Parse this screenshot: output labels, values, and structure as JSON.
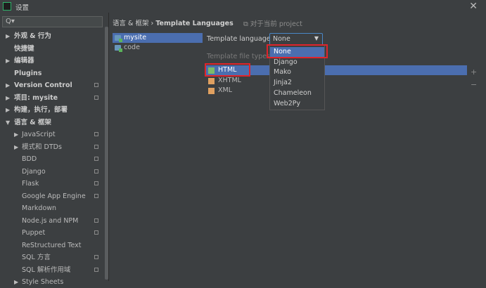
{
  "window": {
    "title": "设置"
  },
  "search": {
    "placeholder": ""
  },
  "sidebar": {
    "items": [
      {
        "label": "外观 & 行为",
        "arrow": "▶",
        "bold": true,
        "indent": 0
      },
      {
        "label": "快捷键",
        "arrow": "",
        "bold": true,
        "indent": 0
      },
      {
        "label": "编辑器",
        "arrow": "▶",
        "bold": true,
        "indent": 0
      },
      {
        "label": "Plugins",
        "arrow": "",
        "bold": true,
        "indent": 0
      },
      {
        "label": "Version Control",
        "arrow": "▶",
        "bold": true,
        "indent": 0,
        "copy": true
      },
      {
        "label": "项目: mysite",
        "arrow": "▶",
        "bold": true,
        "indent": 0,
        "copy": true
      },
      {
        "label": "构建，执行，部署",
        "arrow": "▶",
        "bold": true,
        "indent": 0
      },
      {
        "label": "语言 & 框架",
        "arrow": "▼",
        "bold": true,
        "indent": 0
      },
      {
        "label": "JavaScript",
        "arrow": "▶",
        "bold": false,
        "indent": 1,
        "copy": true
      },
      {
        "label": "模式和 DTDs",
        "arrow": "▶",
        "bold": false,
        "indent": 1,
        "copy": true
      },
      {
        "label": "BDD",
        "arrow": "",
        "bold": false,
        "indent": 1,
        "copy": true
      },
      {
        "label": "Django",
        "arrow": "",
        "bold": false,
        "indent": 1,
        "copy": true
      },
      {
        "label": "Flask",
        "arrow": "",
        "bold": false,
        "indent": 1,
        "copy": true
      },
      {
        "label": "Google App Engine",
        "arrow": "",
        "bold": false,
        "indent": 1,
        "copy": true
      },
      {
        "label": "Markdown",
        "arrow": "",
        "bold": false,
        "indent": 1
      },
      {
        "label": "Node.js and NPM",
        "arrow": "",
        "bold": false,
        "indent": 1,
        "copy": true
      },
      {
        "label": "Puppet",
        "arrow": "",
        "bold": false,
        "indent": 1,
        "copy": true
      },
      {
        "label": "ReStructured Text",
        "arrow": "",
        "bold": false,
        "indent": 1
      },
      {
        "label": "SQL 方言",
        "arrow": "",
        "bold": false,
        "indent": 1,
        "copy": true
      },
      {
        "label": "SQL 解析作用域",
        "arrow": "",
        "bold": false,
        "indent": 1,
        "copy": true
      },
      {
        "label": "Style Sheets",
        "arrow": "▶",
        "bold": false,
        "indent": 1
      }
    ]
  },
  "breadcrumb": {
    "part1": "语言 & 框架",
    "sep": "›",
    "part2": "Template Languages"
  },
  "project_hint": "⧉ 对于当前 project",
  "projects": [
    {
      "label": "mysite",
      "selected": true
    },
    {
      "label": "code",
      "selected": false
    }
  ],
  "template_language": {
    "label": "Template language:",
    "value": "None",
    "options": [
      "None",
      "Django",
      "Mako",
      "Jinja2",
      "Chameleon",
      "Web2Py"
    ]
  },
  "template_file_types": {
    "label": "Template file types",
    "items": [
      {
        "label": "HTML",
        "selected": true
      },
      {
        "label": "XHTML",
        "selected": false
      },
      {
        "label": "XML",
        "selected": false
      }
    ]
  },
  "side_buttons": {
    "add": "+",
    "remove": "−"
  },
  "colors": {
    "selection": "#4b6eaf",
    "highlight_box": "#e0242b",
    "background": "#3c3f41"
  }
}
